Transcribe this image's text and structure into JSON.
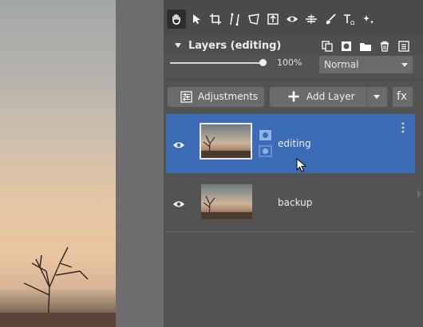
{
  "toolbar": {
    "tools": [
      "hand-icon",
      "pointer-icon",
      "crop-icon",
      "straighten-icon",
      "transform-icon",
      "text-frame-icon",
      "eye-tool-icon",
      "level-icon",
      "brush-icon",
      "text-icon",
      "sparkle-icon"
    ],
    "active_tool": "hand-icon"
  },
  "layers_panel": {
    "title": "Layers (editing)",
    "opacity": "100%",
    "opacity_level": 1.0,
    "blend_mode": "Normal",
    "adjustments_label": "Adjustments",
    "add_layer_label": "Add Layer",
    "fx_label": "fx",
    "layers": [
      {
        "name": "editing",
        "selected": true
      },
      {
        "name": "backup",
        "selected": false
      }
    ]
  },
  "colors": {
    "selection": "#3c6cb5",
    "panel": "#535353"
  }
}
